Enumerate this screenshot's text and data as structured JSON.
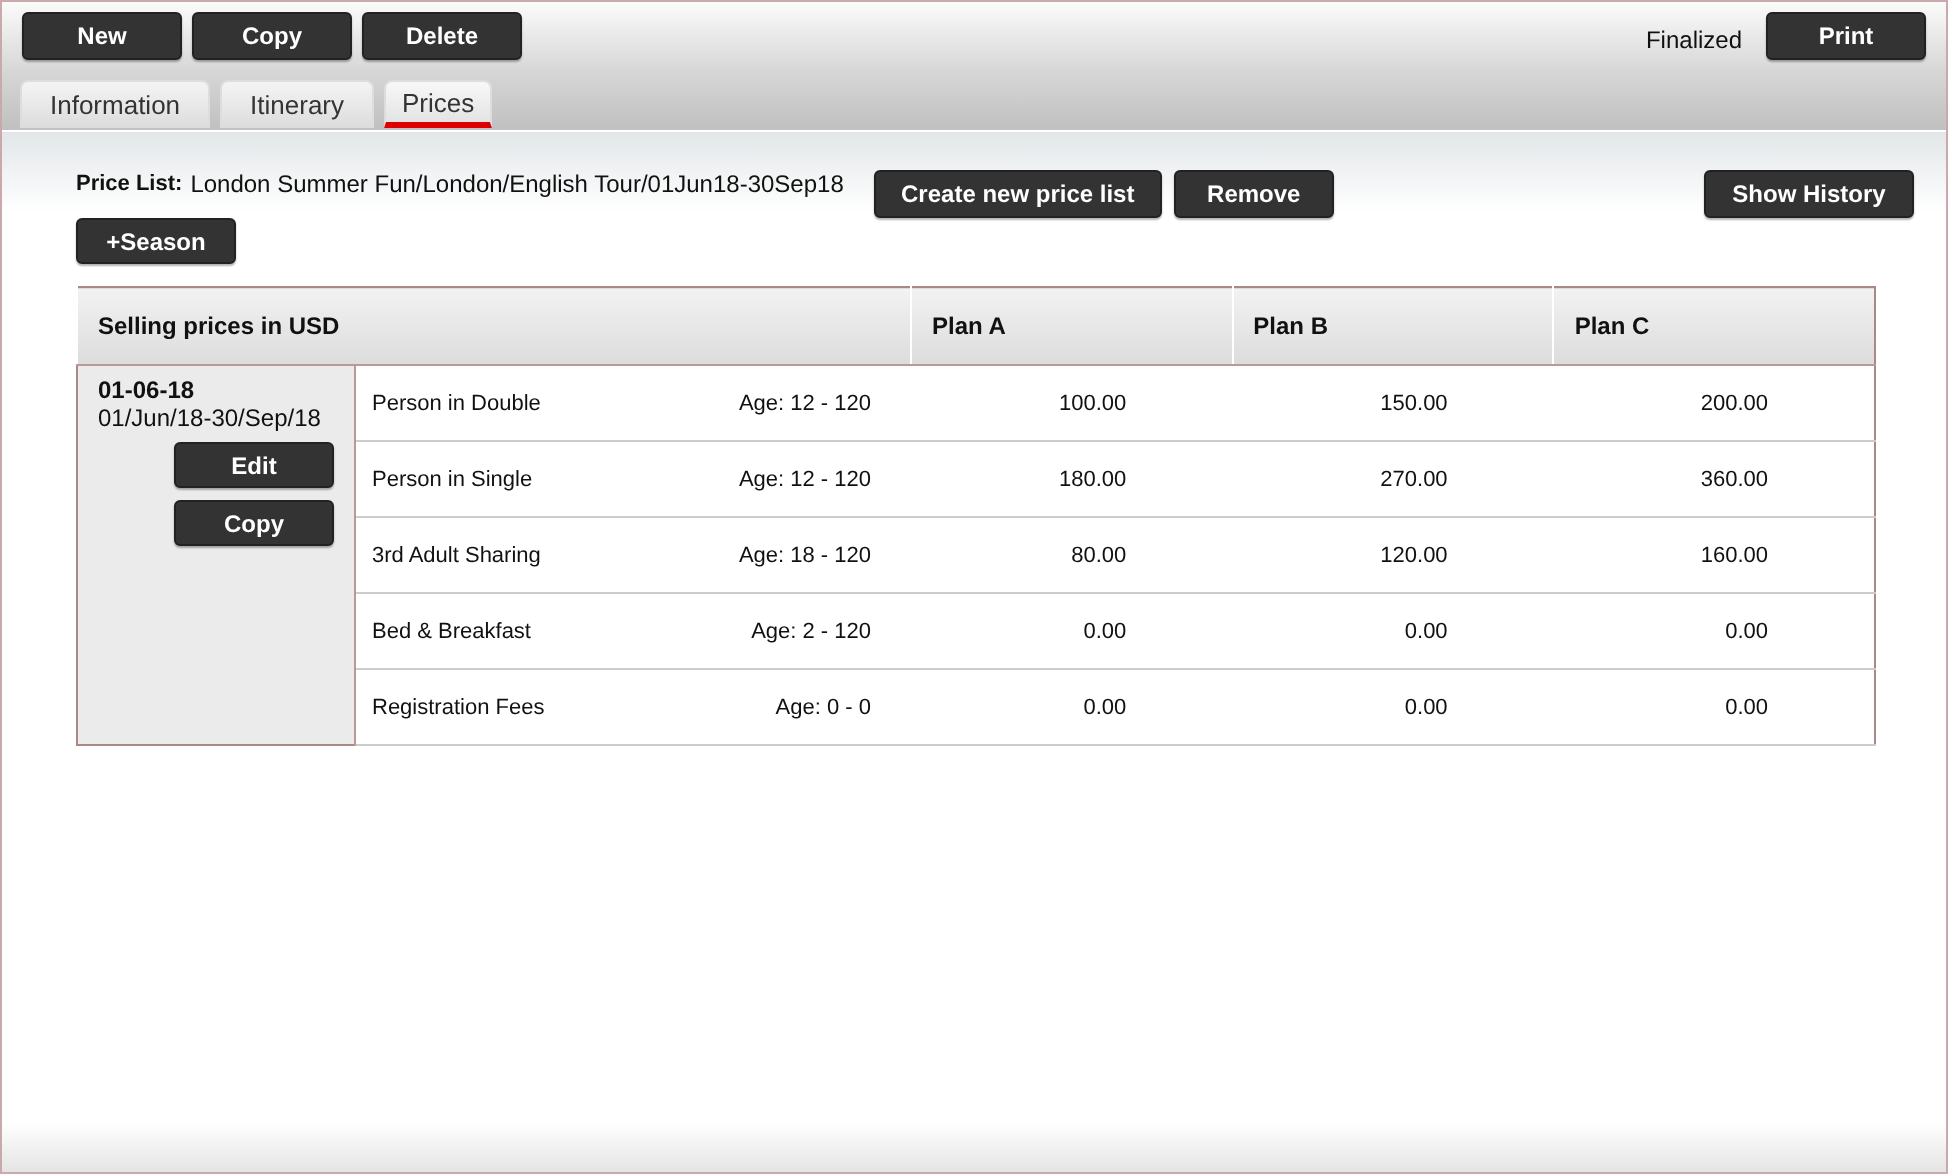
{
  "toolbar": {
    "buttons": [
      "New",
      "Copy",
      "Delete"
    ],
    "status": "Finalized",
    "print_button": "Print"
  },
  "tabs": [
    {
      "label": "Information",
      "selected": false
    },
    {
      "label": "Itinerary",
      "selected": false
    },
    {
      "label": "Prices",
      "selected": true
    }
  ],
  "price_list": {
    "label": "Price List:",
    "value": "London Summer Fun/London/English Tour/01Jun18-30Sep18",
    "buttons": [
      "Create new price list",
      "Remove"
    ],
    "history_button": "Show History"
  },
  "season_button": "+Season",
  "table": {
    "columns": [
      "Selling prices in USD",
      "Plan A",
      "Plan B",
      "Plan C"
    ],
    "season": {
      "code": "01-06-18",
      "range": "01/Jun/18-30/Sep/18",
      "buttons": [
        "Edit",
        "Copy"
      ]
    },
    "rows": [
      {
        "name": "Person in Double",
        "age": "Age: 12 - 120",
        "prices": [
          "100.00",
          "150.00",
          "200.00"
        ]
      },
      {
        "name": "Person in Single",
        "age": "Age: 12 - 120",
        "prices": [
          "180.00",
          "270.00",
          "360.00"
        ]
      },
      {
        "name": "3rd Adult Sharing",
        "age": "Age: 18 - 120",
        "prices": [
          "80.00",
          "120.00",
          "160.00"
        ]
      },
      {
        "name": "Bed & Breakfast",
        "age": "Age: 2 - 120",
        "prices": [
          "0.00",
          "0.00",
          "0.00"
        ]
      },
      {
        "name": "Registration Fees",
        "age": "Age: 0 - 0",
        "prices": [
          "0.00",
          "0.00",
          "0.00"
        ]
      }
    ]
  }
}
